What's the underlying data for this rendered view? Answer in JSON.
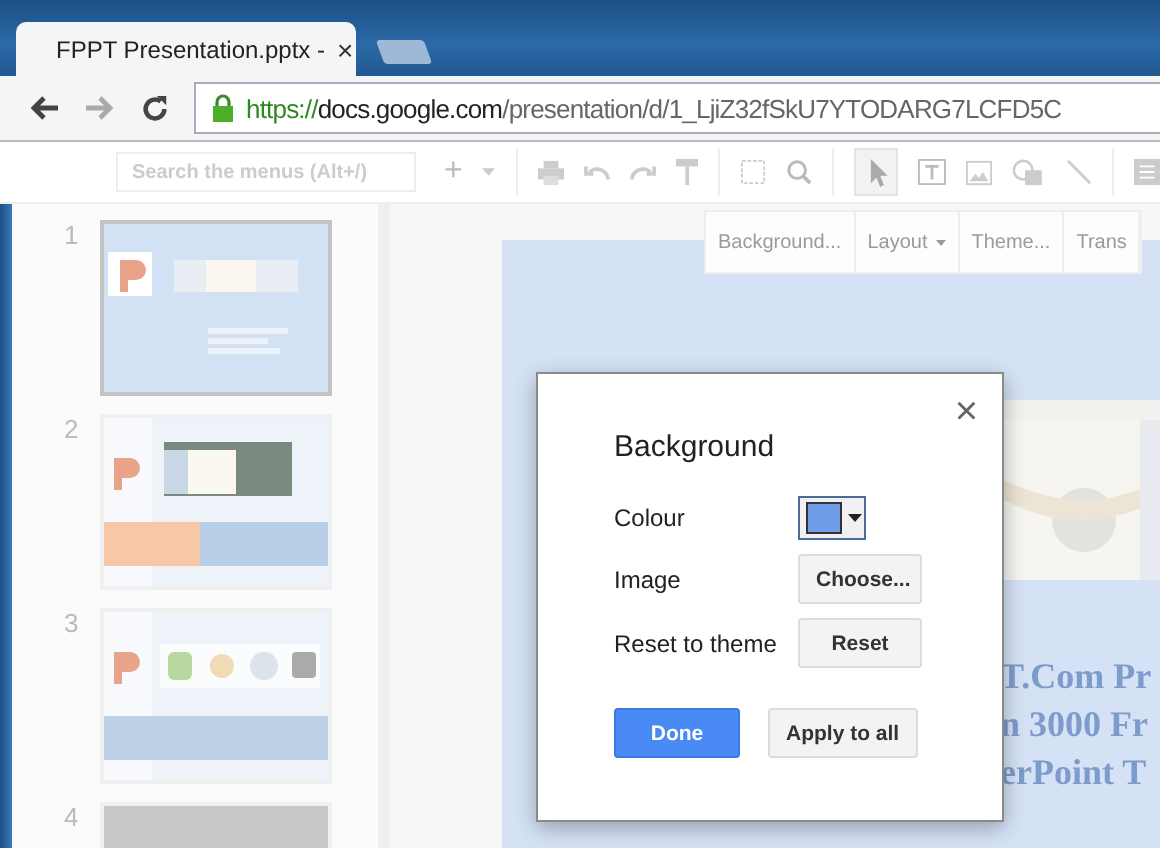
{
  "browser": {
    "tab": {
      "title": "FPPT Presentation.pptx -",
      "close": "×"
    },
    "url": {
      "scheme": "https://",
      "host": "docs.google.com",
      "path": "/presentation/d/1_LjiZ32fSkU7YTODARG7LCFD5C"
    }
  },
  "toolbar": {
    "search": {
      "placeholder": "Search the menus (Alt+/)"
    },
    "add": "+"
  },
  "slide_toolbar": [
    {
      "label": "Background...",
      "caret": false
    },
    {
      "label": "Layout",
      "caret": true
    },
    {
      "label": "Theme...",
      "caret": false
    },
    {
      "label": "Trans",
      "caret": false
    }
  ],
  "filmstrip": [
    {
      "number": "1",
      "selected": true,
      "kind": "title"
    },
    {
      "number": "2",
      "selected": false,
      "kind": "banner"
    },
    {
      "number": "3",
      "selected": false,
      "kind": "icons"
    },
    {
      "number": "4",
      "selected": false,
      "kind": "blank"
    }
  ],
  "slide": {
    "text_lines": [
      "T.Com Pr",
      "n 3000 Fr",
      "erPoint T"
    ]
  },
  "dialog": {
    "title": "Background",
    "close": "×",
    "rows": [
      {
        "label": "Colour",
        "kind": "color",
        "color": "#6f9de8"
      },
      {
        "label": "Image",
        "kind": "button",
        "button": "Choose..."
      },
      {
        "label": "Reset to theme",
        "kind": "button",
        "button": "Reset"
      }
    ],
    "buttons": [
      {
        "label": "Done",
        "primary": true
      },
      {
        "label": "Apply to all",
        "primary": false
      }
    ]
  }
}
